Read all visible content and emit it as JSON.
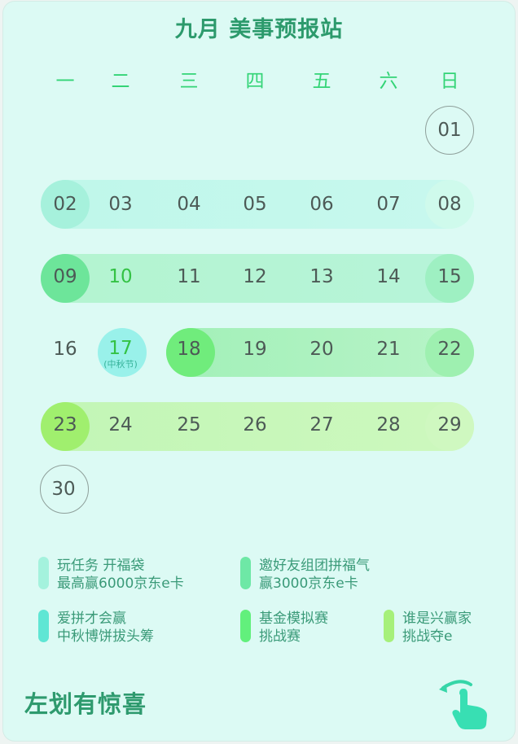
{
  "header": {
    "title": "九月 美事预报站"
  },
  "weekdays": [
    "一",
    "二",
    "三",
    "四",
    "五",
    "六",
    "日"
  ],
  "days": {
    "d01": "01",
    "d02": "02",
    "d03": "03",
    "d04": "04",
    "d05": "05",
    "d06": "06",
    "d07": "07",
    "d08": "08",
    "d09": "09",
    "d10": "10",
    "d11": "11",
    "d12": "12",
    "d13": "13",
    "d14": "14",
    "d15": "15",
    "d16": "16",
    "d17": "17",
    "d18": "18",
    "d19": "19",
    "d20": "20",
    "d21": "21",
    "d22": "22",
    "d23": "23",
    "d24": "24",
    "d25": "25",
    "d26": "26",
    "d27": "27",
    "d28": "28",
    "d29": "29",
    "d30": "30"
  },
  "holiday": {
    "label": "(中秋节)"
  },
  "legend": [
    {
      "line1": "玩任务 开福袋",
      "line2": "最高赢6000京东e卡",
      "color": "#a4f2dd"
    },
    {
      "line1": "邀好友组团拼福气",
      "line2": "赢3000京东e卡",
      "color": "#6ee8a6"
    },
    {
      "line1": "爱拼才会赢",
      "line2": "中秋博饼拔头筹",
      "color": "#5fe6d4"
    },
    {
      "line1": "基金模拟赛",
      "line2": "挑战赛",
      "color": "#62f07c"
    },
    {
      "line1": "谁是兴赢家",
      "line2": "挑战夺e",
      "color": "#a6f07a"
    }
  ],
  "footer": {
    "hint": "左划有惊喜"
  },
  "icons": {
    "swipe": "swipe-left-hand-icon"
  }
}
